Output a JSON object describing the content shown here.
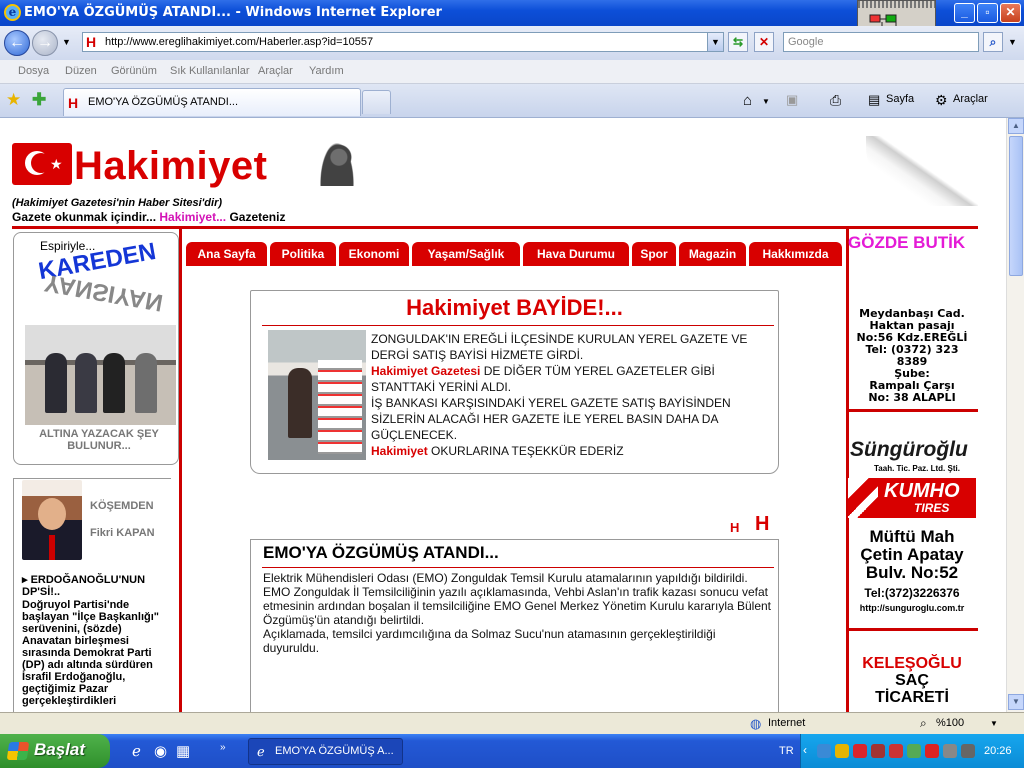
{
  "window": {
    "title": "EMO'YA ÖZGÜMÜŞ ATANDI... - Windows Internet Explorer"
  },
  "address": {
    "url": "http://www.ereglihakimiyet.com/Haberler.asp?id=10557",
    "search_placeholder": "Google"
  },
  "menu": [
    "Dosya",
    "Düzen",
    "Görünüm",
    "Sık Kullanılanlar",
    "Araçlar",
    "Yardım"
  ],
  "tab": {
    "label": "EMO'YA ÖZGÜMÜŞ ATANDI..."
  },
  "toolbar": {
    "page_label": "Sayfa",
    "tools_label": "Araçlar"
  },
  "site": {
    "brand": "Hakimiyet",
    "tagline": "(Hakimiyet Gazetesi'nin Haber Sitesi'dir)",
    "read_prefix": "Gazete okunmak içindir...",
    "read_brand": "Hakimiyet...",
    "read_suffix": "Gazeteniz"
  },
  "left": {
    "espiri": "Espiriyle...",
    "kareden": "KAREDEN",
    "kareden_mirror": "YANSIYAN",
    "caption": "ALTINA YAZACAK ŞEY BULUNUR...",
    "kosem": "KÖŞEMDEN",
    "author": "Fikri KAPAN",
    "headline": "ERDOĞANOĞLU'NUN DP'Sİ!..",
    "excerpt": "Doğruyol Partisi'nde başlayan \"İlçe Başkanlığı\" serüvenini, (sözde) Anavatan birleşmesi sırasında Demokrat Parti (DP) adı altında sürdüren İsrafil Erdoğanoğlu, geçtiğimiz Pazar gerçekleştirdikleri"
  },
  "nav": [
    "Ana Sayfa",
    "Politika",
    "Ekonomi",
    "Yaşam/Sağlık",
    "Hava Durumu",
    "Spor",
    "Magazin",
    "Hakkımızda"
  ],
  "bayide": {
    "title": "Hakimiyet BAYİDE!...",
    "line1": "ZONGULDAK'IN EREĞLİ İLÇESİNDE KURULAN YEREL GAZETE VE DERGİ SATIŞ BAYİSİ HİZMETE GİRDİ.",
    "red1": "Hakimiyet Gazetesi",
    "line2": " DE DİĞER TÜM YEREL GAZETELER GİBİ STANTTAKİ YERİNİ ALDI.",
    "line3": "İŞ BANKASI KARŞISINDAKİ YEREL GAZETE SATIŞ BAYİSİNDEN SİZLERİN ALACAĞI HER GAZETE İLE YEREL BASIN  DAHA DA GÜÇLENECEK.",
    "red2": "Hakimiyet",
    "line4": " OKURLARINA TEŞEKKÜR EDERİZ"
  },
  "font_controls": {
    "small": "H",
    "large": "H"
  },
  "article": {
    "title": "EMO'YA ÖZGÜMÜŞ ATANDI...",
    "p1": "Elektrik Mühendisleri Odası (EMO) Zonguldak Temsil Kurulu atamalarının yapıldığı bildirildi.",
    "p2": "EMO Zonguldak İl Temsilciliğinin yazılı açıklamasında, Vehbi Aslan'ın trafik kazası sonucu vefat etmesinin ardından boşalan il temsilciliğine EMO Genel Merkez Yönetim Kurulu kararıyla Bülent Özgümüş'ün atandığı belirtildi.",
    "p3": "Açıklamada, temsilci yardımcılığına da Solmaz Sucu'nun atamasının gerçekleştirildiği duyuruldu."
  },
  "right": {
    "gozde": "GÖZDE BUTİK",
    "gozde_addr": [
      "Meydanbaşı Cad.",
      "Haktan pasajı",
      "No:56 Kdz.EREĞLİ",
      "Tel: (0372) 323 8389",
      "Şube:",
      "Rampalı Çarşı",
      "No: 38  ALAPLI"
    ],
    "sungur": "Süngüroğlu",
    "sungur_sub": "Taah. Tic. Paz. Ltd. Şti.",
    "kumho": "KUMHO",
    "tires": "TIRES",
    "muftu": [
      "Müftü Mah",
      "Çetin Apatay",
      "Bulv. No:52"
    ],
    "tel": "Tel:(372)3226376",
    "url": "http://sunguroglu.com.tr",
    "keles": "KELEŞOĞLU",
    "sac": "SAÇ",
    "ticareti": "TİCARETİ"
  },
  "status": {
    "zone": "Internet",
    "zoom": "%100"
  },
  "taskbar": {
    "start": "Başlat",
    "task": "EMO'YA ÖZGÜMÜŞ A...",
    "lang": "TR",
    "clock": "20:26"
  }
}
